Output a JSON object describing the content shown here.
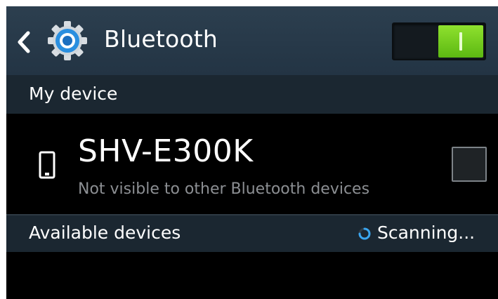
{
  "action_bar": {
    "title": "Bluetooth",
    "back_icon": "chevron-left-icon",
    "app_icon": "gear-icon",
    "toggle": {
      "state": "on",
      "accent": "#6fcc1c"
    }
  },
  "my_device_section": {
    "header": "My device",
    "device": {
      "name": "SHV-E300K",
      "status": "Not visible to other Bluetooth devices",
      "icon": "phone-icon",
      "visible_checkbox": false
    }
  },
  "available_section": {
    "header": "Available devices",
    "scan_status": "Scanning...",
    "spinner_icon": "spinner-icon"
  },
  "colors": {
    "action_bar": "#293b4b",
    "section_header": "#1b2731",
    "background": "#000000",
    "secondary_text": "#8c8f93"
  }
}
